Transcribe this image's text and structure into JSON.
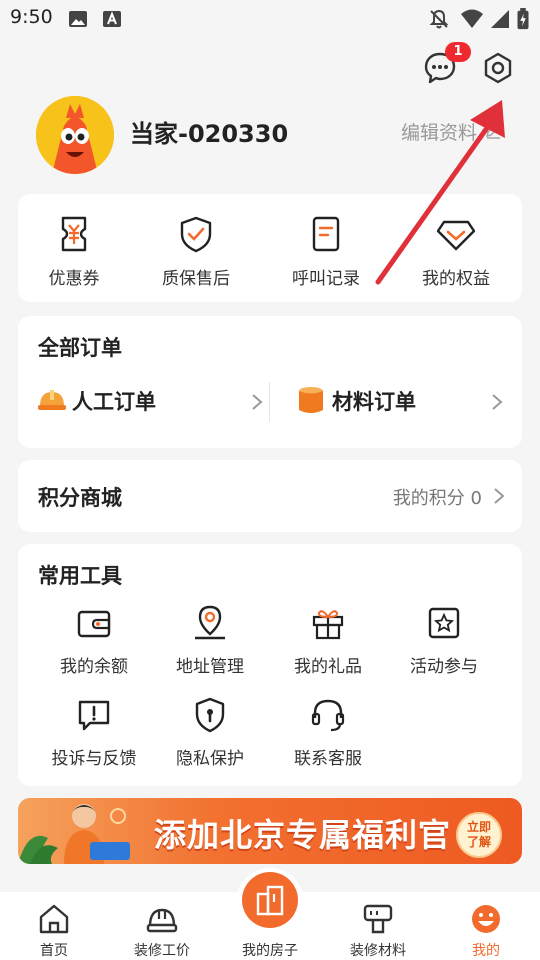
{
  "status_bar": {
    "time": "9:50",
    "icons": [
      "image-icon",
      "text-a-icon",
      "mute-bell-icon",
      "wifi-icon",
      "signal-icon",
      "battery-charging-icon"
    ]
  },
  "header": {
    "message_badge": "1",
    "icons": [
      "message-bubble-icon",
      "settings-hex-icon"
    ]
  },
  "profile": {
    "username": "当家-020330",
    "edit_label": "编辑资料"
  },
  "quick_actions": [
    {
      "label": "优惠券",
      "icon": "coupon-icon"
    },
    {
      "label": "质保售后",
      "icon": "shield-check-icon"
    },
    {
      "label": "呼叫记录",
      "icon": "call-record-icon"
    },
    {
      "label": "我的权益",
      "icon": "diamond-icon"
    }
  ],
  "orders": {
    "title": "全部订单",
    "labor_label": "人工订单",
    "material_label": "材料订单"
  },
  "points": {
    "title": "积分商城",
    "my_points_label": "我的积分",
    "my_points_value": "0"
  },
  "tools": {
    "title": "常用工具",
    "items": [
      {
        "label": "我的余额",
        "icon": "wallet-icon"
      },
      {
        "label": "地址管理",
        "icon": "location-pin-icon"
      },
      {
        "label": "我的礼品",
        "icon": "gift-icon"
      },
      {
        "label": "活动参与",
        "icon": "star-card-icon"
      },
      {
        "label": "投诉与反馈",
        "icon": "feedback-icon"
      },
      {
        "label": "隐私保护",
        "icon": "privacy-shield-icon"
      },
      {
        "label": "联系客服",
        "icon": "headset-icon"
      }
    ]
  },
  "banner": {
    "text": "添加北京专属福利官",
    "cta_line1": "立即",
    "cta_line2": "了解"
  },
  "bottom_nav": [
    {
      "label": "首页",
      "icon": "home-icon"
    },
    {
      "label": "装修工价",
      "icon": "helmet-icon"
    },
    {
      "label": "我的房子",
      "icon": "building-icon"
    },
    {
      "label": "装修材料",
      "icon": "paint-roller-icon"
    },
    {
      "label": "我的",
      "icon": "mascot-face-icon"
    }
  ],
  "colors": {
    "accent": "#f26b2d",
    "badge": "#f0282f",
    "annotation_arrow": "#e0313a",
    "background": "#f5f5f5"
  }
}
